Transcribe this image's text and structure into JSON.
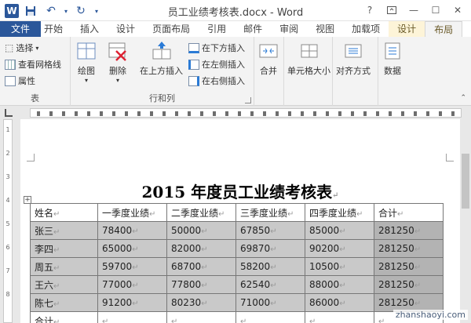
{
  "window": {
    "title": "员工业绩考核表.docx - Word",
    "controls": [
      "?",
      "—",
      "☐",
      "✕"
    ]
  },
  "tabs": [
    {
      "label": "文件",
      "kind": "file"
    },
    {
      "label": "开始",
      "kind": "normal"
    },
    {
      "label": "插入",
      "kind": "normal"
    },
    {
      "label": "设计",
      "kind": "normal"
    },
    {
      "label": "页面布局",
      "kind": "normal"
    },
    {
      "label": "引用",
      "kind": "normal"
    },
    {
      "label": "邮件",
      "kind": "normal"
    },
    {
      "label": "审阅",
      "kind": "normal"
    },
    {
      "label": "视图",
      "kind": "normal"
    },
    {
      "label": "加载项",
      "kind": "normal"
    },
    {
      "label": "设计",
      "kind": "context"
    },
    {
      "label": "布局",
      "kind": "context-active"
    }
  ],
  "ribbon": {
    "table_group": {
      "label": "表",
      "select": "选择",
      "gridlines": "查看网格线",
      "properties": "属性"
    },
    "rows_cols_group": {
      "label": "行和列",
      "draw": "绘图",
      "delete": "删除",
      "insert_above": "在上方插入",
      "insert_below": "在下方插入",
      "insert_left": "在左侧插入",
      "insert_right": "在右侧插入"
    },
    "merge": "合并",
    "cell_size": "单元格大小",
    "alignment": "对齐方式",
    "data": "数据"
  },
  "vruler_numbers": [
    "1",
    "2",
    "3",
    "4",
    "5",
    "6",
    "7",
    "8"
  ],
  "document": {
    "title": "2015 年度员工业绩考核表",
    "table": {
      "header": [
        "姓名",
        "一季度业绩",
        "二季度业绩",
        "三季度业绩",
        "四季度业绩",
        "合计"
      ],
      "rows": [
        [
          "张三",
          "78400",
          "50000",
          "67850",
          "85000",
          "281250"
        ],
        [
          "李四",
          "65000",
          "82000",
          "69870",
          "90200",
          "281250"
        ],
        [
          "周五",
          "59700",
          "68700",
          "58200",
          "10500",
          "281250"
        ],
        [
          "王六",
          "77000",
          "77800",
          "62540",
          "88000",
          "281250"
        ],
        [
          "陈七",
          "91200",
          "80230",
          "71000",
          "86000",
          "281250"
        ]
      ],
      "footer": [
        "合计",
        "",
        "",
        "",
        "",
        ""
      ]
    }
  },
  "watermark": "zhanshaoyi.com"
}
